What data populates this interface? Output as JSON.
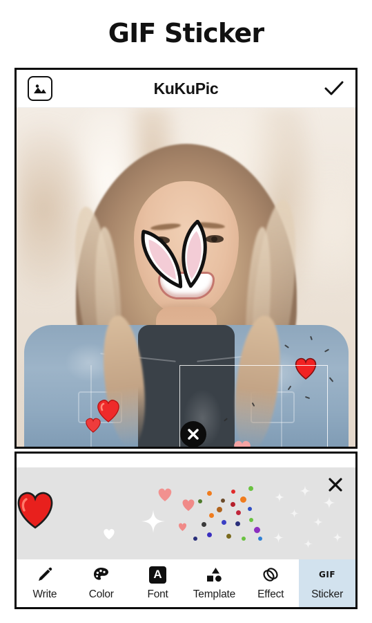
{
  "page": {
    "title": "GIF Sticker",
    "background": "#ffffff"
  },
  "app_header": {
    "title": "KuKuPic",
    "gallery_icon": "image-gallery-icon",
    "confirm_icon": "checkmark-icon"
  },
  "photo_canvas": {
    "description": "Photo of smiling blonde woman in denim jacket outdoors",
    "stickers": [
      {
        "name": "bunny-ears",
        "type": "bunny-ears",
        "fill": "#f3cdd7"
      },
      {
        "name": "heart-red-large",
        "type": "heart",
        "color": "#ef2a2a"
      },
      {
        "name": "heart-red-small",
        "type": "heart",
        "color": "#ef3c3c"
      },
      {
        "name": "heart-red-right",
        "type": "heart",
        "color": "#f12222"
      },
      {
        "name": "heart-pink-1",
        "type": "heart",
        "color": "#f4a3a3"
      },
      {
        "name": "heart-pink-2",
        "type": "heart",
        "color": "#f3a0a0"
      },
      {
        "name": "heart-pink-3",
        "type": "heart",
        "color": "#f29a9a"
      }
    ],
    "selection": {
      "delete_icon": "close-x-icon",
      "resize_icon": "resize-equals-icon"
    }
  },
  "sticker_panel": {
    "close_icon": "close-x-icon",
    "background": "#e2e2e2",
    "items": [
      {
        "name": "big-red-heart",
        "color": "#e8201d"
      },
      {
        "name": "pink-heart-a",
        "color": "#f2918f"
      },
      {
        "name": "pink-heart-b",
        "color": "#f08a88"
      },
      {
        "name": "pink-heart-c",
        "color": "#f08a88"
      },
      {
        "name": "white-heart",
        "color": "#ffffff"
      },
      {
        "name": "sparkle-cross",
        "color": "#ffffff"
      },
      {
        "name": "confetti-dots",
        "colors": [
          "#f07c1e",
          "#e02b2b",
          "#6ac241",
          "#3b3fc4",
          "#8c2fbf",
          "#2f7fd4"
        ]
      },
      {
        "name": "white-stars",
        "color": "#f7f7f7"
      }
    ]
  },
  "toolbar": {
    "active_color": "#d2e2ee",
    "tools": [
      {
        "label": "Write",
        "icon": "pencil-icon",
        "active": false
      },
      {
        "label": "Color",
        "icon": "palette-icon",
        "active": false
      },
      {
        "label": "Font",
        "icon": "font-letter-a-icon",
        "active": false,
        "glyph": "A"
      },
      {
        "label": "Template",
        "icon": "shapes-icon",
        "active": false
      },
      {
        "label": "Effect",
        "icon": "overlapping-rings-icon",
        "active": false
      },
      {
        "label": "Sticker",
        "icon": "gif-icon",
        "active": true,
        "glyph": "GIF"
      }
    ]
  }
}
